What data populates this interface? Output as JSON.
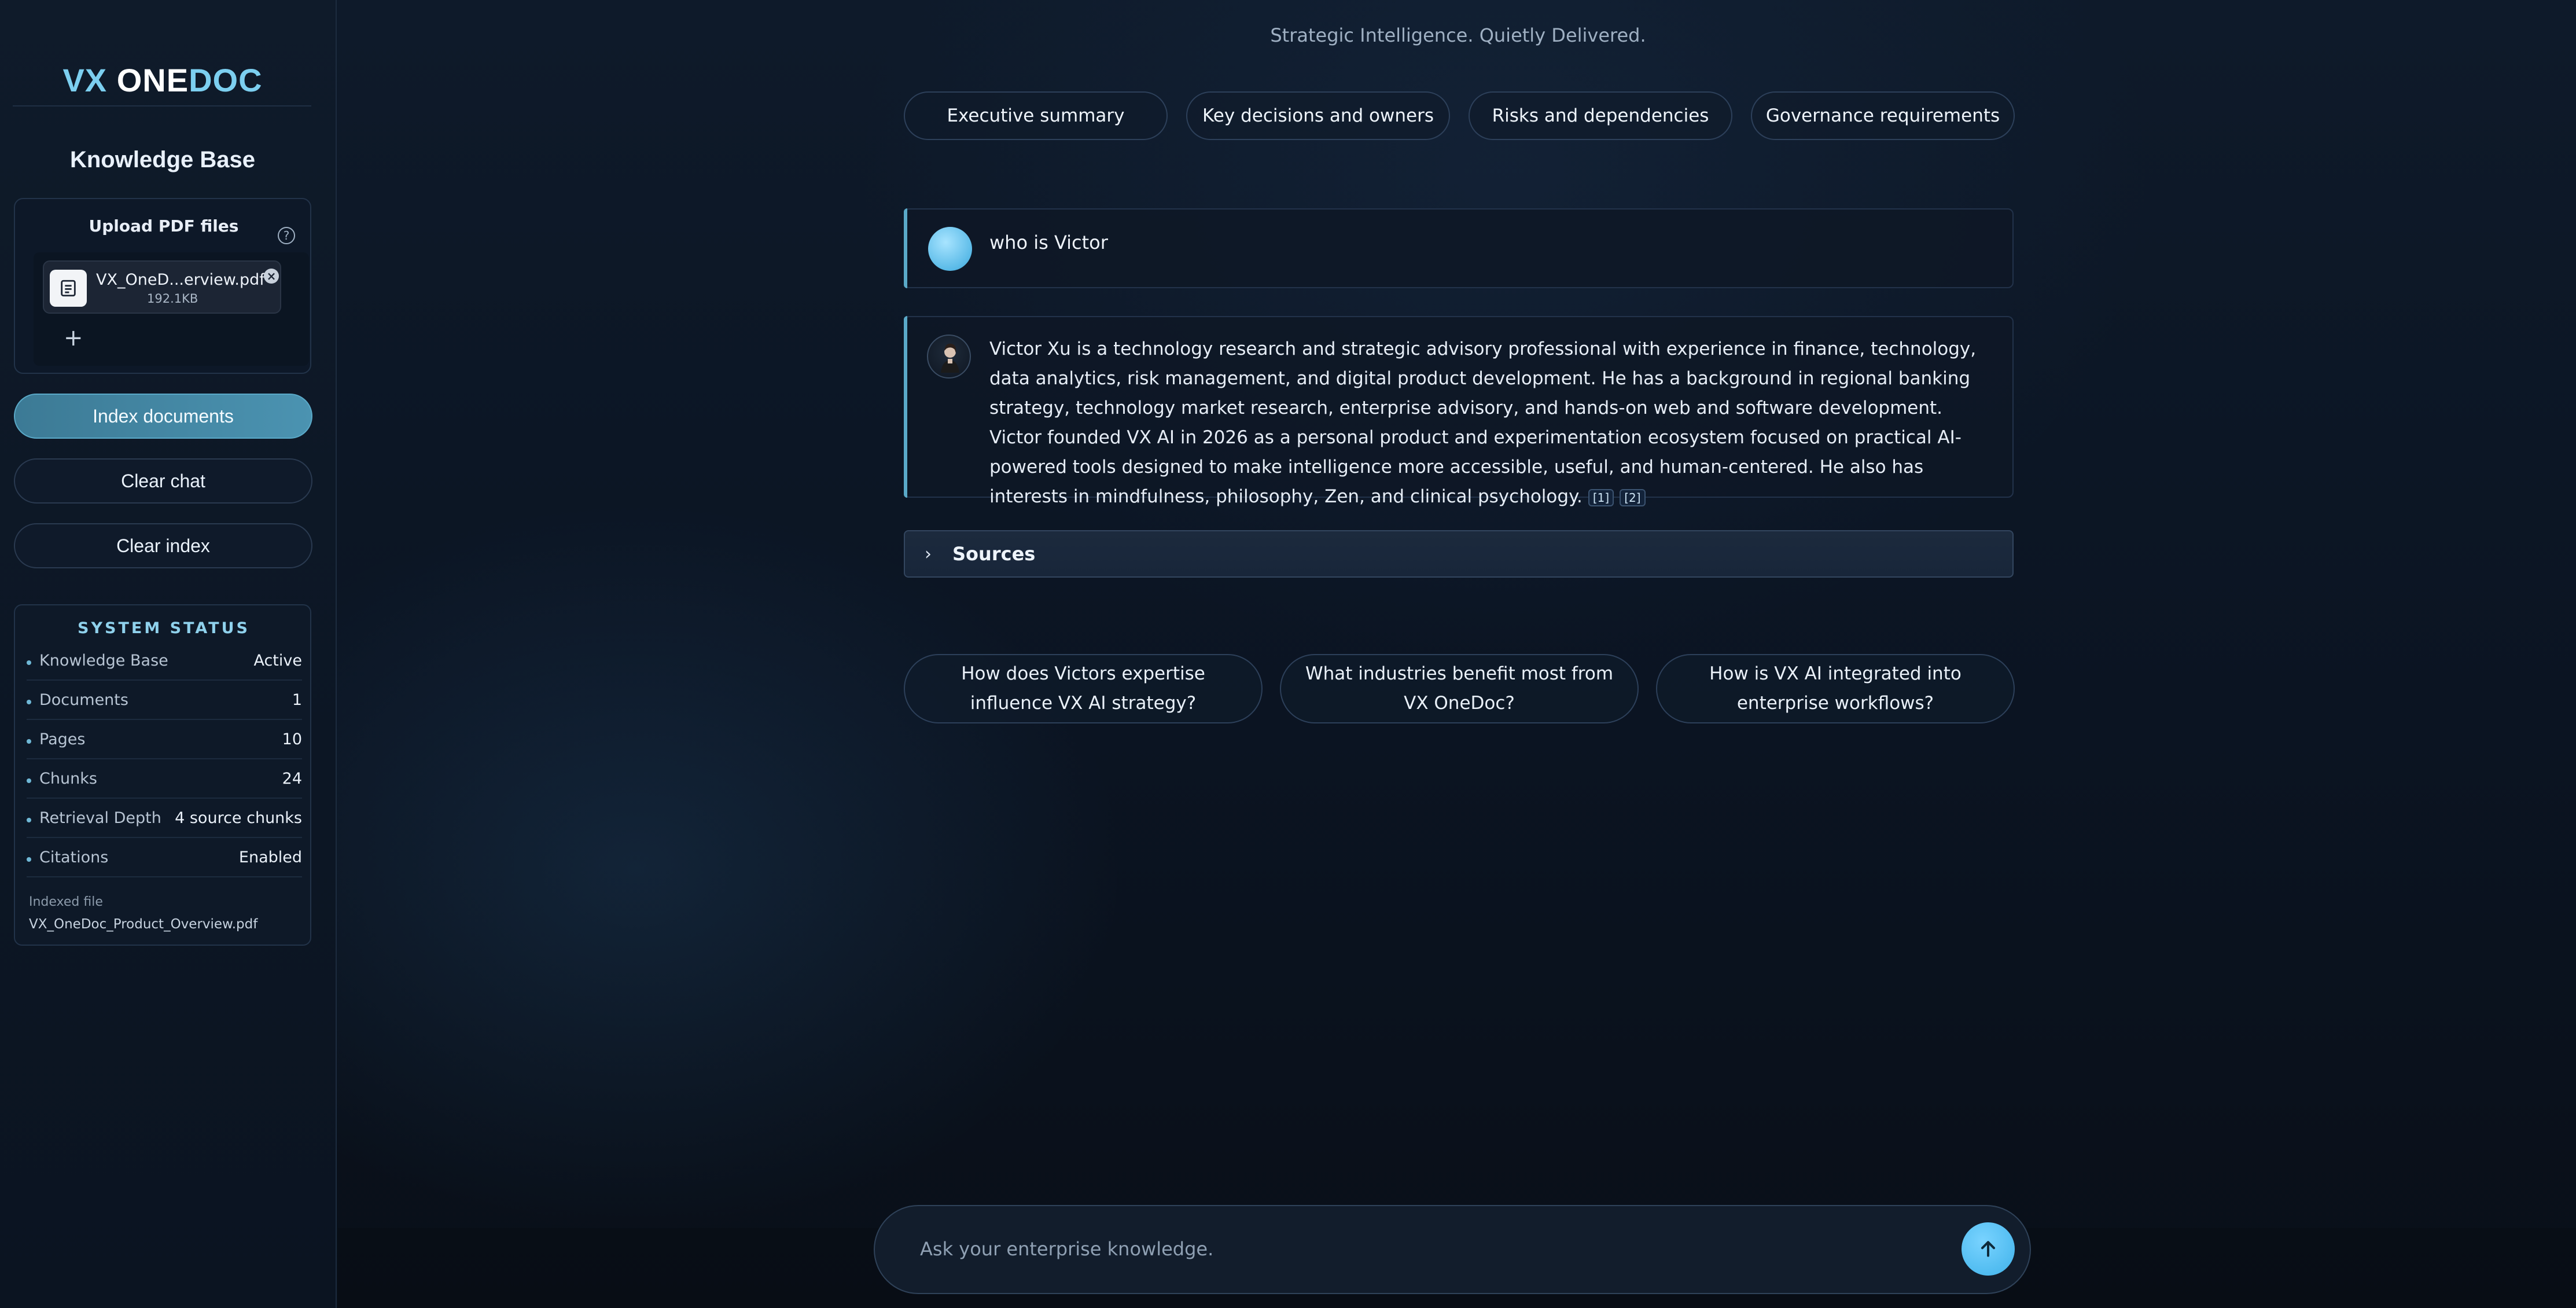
{
  "brand": {
    "part1": "VX",
    "part2": "ONE",
    "part3": "DOC"
  },
  "sidebar": {
    "kb_title": "Knowledge Base",
    "upload": {
      "title": "Upload PDF files",
      "file_name": "VX_OneD...erview.pdf",
      "file_size": "192.1KB"
    },
    "buttons": {
      "index": "Index documents",
      "clear_chat": "Clear chat",
      "clear_index": "Clear index"
    },
    "status": {
      "title": "SYSTEM STATUS",
      "rows": [
        {
          "label": "Knowledge Base",
          "value": "Active"
        },
        {
          "label": "Documents",
          "value": "1"
        },
        {
          "label": "Pages",
          "value": "10"
        },
        {
          "label": "Chunks",
          "value": "24"
        },
        {
          "label": "Retrieval Depth",
          "value": "4 source chunks"
        },
        {
          "label": "Citations",
          "value": "Enabled"
        }
      ],
      "indexed_label": "Indexed file",
      "indexed_file": "VX_OneDoc_Product_Overview.pdf"
    }
  },
  "main": {
    "tagline": "Strategic Intelligence. Quietly Delivered.",
    "chips": [
      "Executive summary",
      "Key decisions and owners",
      "Risks and dependencies",
      "Governance requirements"
    ],
    "user_message": "who is Victor",
    "assistant_message": "Victor Xu is a technology research and strategic advisory professional with experience in finance, technology, data analytics, risk management, and digital product development. He has a background in regional banking strategy, technology market research, enterprise advisory, and hands-on web and software development. Victor founded VX AI in 2026 as a personal product and experimentation ecosystem focused on practical AI-powered tools designed to make intelligence more accessible, useful, and human-centered. He also has interests in mindfulness, philosophy, Zen, and clinical psychology.",
    "citations": [
      "[1]",
      "[2]"
    ],
    "sources_label": "Sources",
    "suggestions": [
      "How does Victors expertise influence VX AI strategy?",
      "What industries benefit most from VX OneDoc?",
      "How is VX AI integrated into enterprise workflows?"
    ],
    "composer": {
      "placeholder": "Ask your enterprise knowledge."
    }
  },
  "colors": {
    "accent": "#5aa9c8",
    "brand_accent": "#7ccff0",
    "background": "#0d1624"
  },
  "icons": {
    "help": "help-circle-icon",
    "file": "document-icon",
    "remove": "close-circle-icon",
    "add": "plus-icon",
    "chevron": "chevron-right-icon",
    "send": "arrow-up-icon"
  }
}
